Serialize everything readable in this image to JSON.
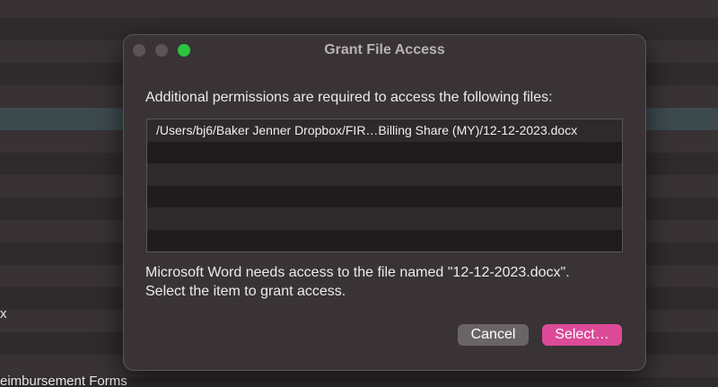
{
  "background": {
    "text_x": "x",
    "text_reimbursement": "eimbursement Forms"
  },
  "dialog": {
    "title": "Grant File Access",
    "message_permissions": "Additional permissions are required to access the following files:",
    "files": [
      "/Users/bj6/Baker Jenner Dropbox/FIR…Billing Share (MY)/12-12-2023.docx",
      "",
      "",
      "",
      "",
      ""
    ],
    "message_line1": "Microsoft Word needs access to the file named \"12-12-2023.docx\".",
    "message_line2": "Select the item to grant access.",
    "cancel_label": "Cancel",
    "select_label": "Select…"
  },
  "colors": {
    "accent": "#dc4a98",
    "zoom_button": "#2ac440",
    "window_bg": "#393335"
  }
}
